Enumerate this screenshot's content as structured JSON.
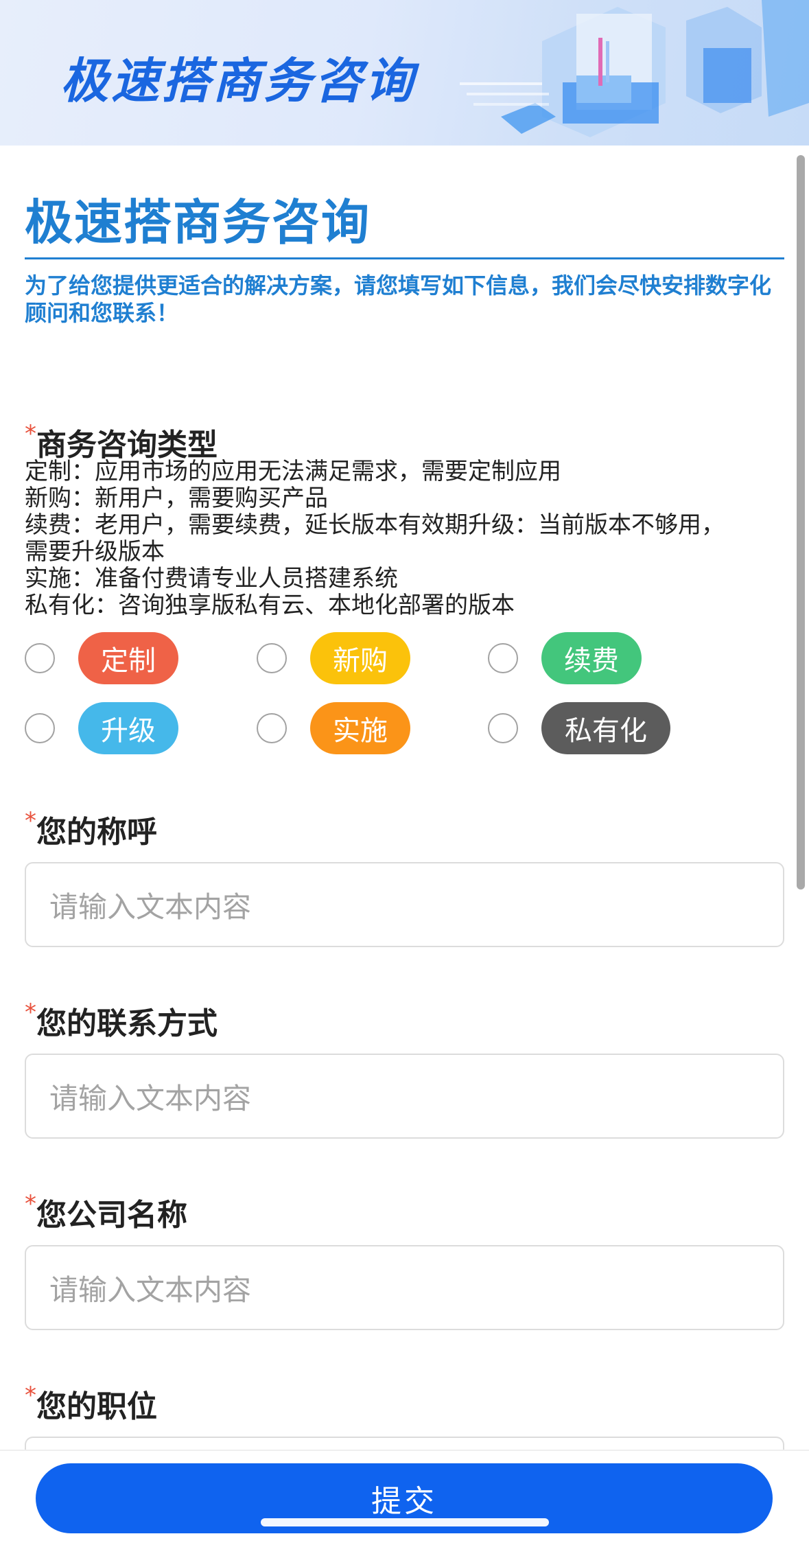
{
  "banner": {
    "title": "极速搭商务咨询"
  },
  "form": {
    "title": "极速搭商务咨询",
    "intro": "为了给您提供更适合的解决方案，请您填写如下信息，我们会尽快安排数字化顾问和您联系！",
    "required_mark": "*",
    "consult_type": {
      "label": "商务咨询类型",
      "description": [
        "定制：应用市场的应用无法满足需求，需要定制应用",
        "新购：新用户，需要购买产品",
        "续费：老用户，需要续费，延长版本有效期升级：当前版本不够用，",
        "需要升级版本",
        "实施：准备付费请专业人员搭建系统",
        "私有化：咨询独享版私有云、本地化部署的版本"
      ],
      "options": [
        {
          "label": "定制",
          "color": "#ef6247"
        },
        {
          "label": "新购",
          "color": "#fbc20b"
        },
        {
          "label": "续费",
          "color": "#43c67c"
        },
        {
          "label": "升级",
          "color": "#45b8ea"
        },
        {
          "label": "实施",
          "color": "#fb9418"
        },
        {
          "label": "私有化",
          "color": "#5c5c5c"
        }
      ]
    },
    "name": {
      "label": "您的称呼",
      "placeholder": "请输入文本内容"
    },
    "contact": {
      "label": "您的联系方式",
      "placeholder": "请输入文本内容"
    },
    "company": {
      "label": "您公司名称",
      "placeholder": "请输入文本内容"
    },
    "position": {
      "label": "您的职位"
    }
  },
  "submit": {
    "label": "提交"
  }
}
